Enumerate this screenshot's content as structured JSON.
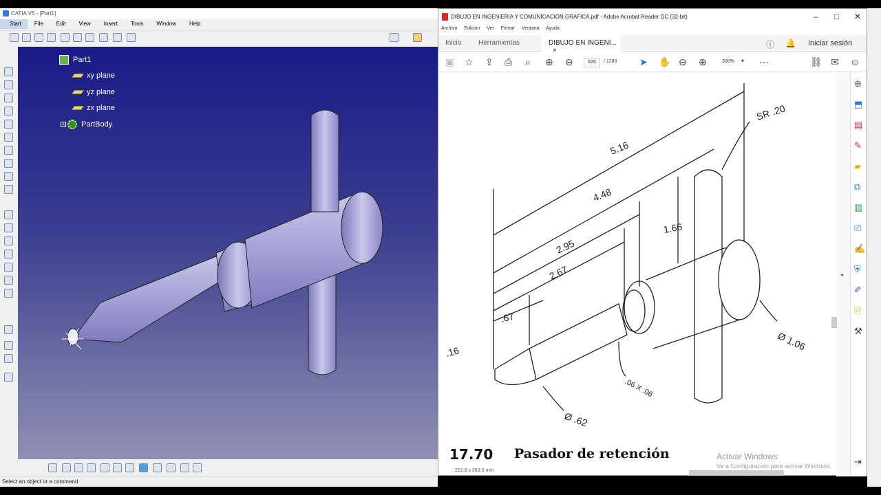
{
  "catia": {
    "title": "CATIA V5 - [Part1]",
    "menu": [
      "Start",
      "File",
      "Edit",
      "View",
      "Insert",
      "Tools",
      "Window",
      "Help"
    ],
    "tree": {
      "root": "Part1",
      "items": [
        "xy plane",
        "yz plane",
        "zx plane"
      ],
      "body": "PartBody"
    },
    "status": "Select an object or a command"
  },
  "acrobat": {
    "title": "DIBUJO EN INGENIERIA Y COMUNICACION GRAFICA.pdf - Adobe Acrobat Reader DC (32-bit)",
    "menu": [
      "Archivo",
      "Edición",
      "Ver",
      "Firmar",
      "Ventana",
      "Ayuda"
    ],
    "tabs": {
      "home": "Inicio",
      "tools": "Herramientas",
      "doc": "DIBUJO EN INGENI..."
    },
    "signin": "Iniciar sesión",
    "page_current": "826",
    "page_total": "/ 1286",
    "zoom": "300%",
    "page_size": "212.8 x 283.3 mm",
    "caption_number": "17.70",
    "caption_text": "Pasador de retención",
    "watermark_title": "Activar Windows",
    "watermark_sub": "Ve a Configuración para activar Windows.",
    "dims": [
      "5.16",
      "4.48",
      "2.95",
      "2.67",
      "1.66",
      ".67",
      ".16",
      "SR .20",
      "Ø 1.06",
      "Ø .62",
      ".06 X .06"
    ]
  }
}
